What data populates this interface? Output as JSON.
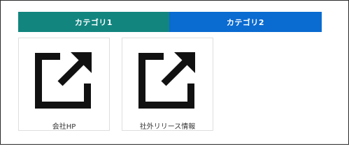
{
  "colors": {
    "tab_active": "#12857f",
    "tab_inactive": "#0a6bd1",
    "icon": "#111111"
  },
  "tabs": [
    {
      "label": "カテゴリ1",
      "active": true
    },
    {
      "label": "カテゴリ2",
      "active": false
    }
  ],
  "tiles": [
    {
      "label": "会社HP",
      "icon": "external-link-icon"
    },
    {
      "label": "社外リリース情報",
      "icon": "external-link-icon"
    }
  ]
}
